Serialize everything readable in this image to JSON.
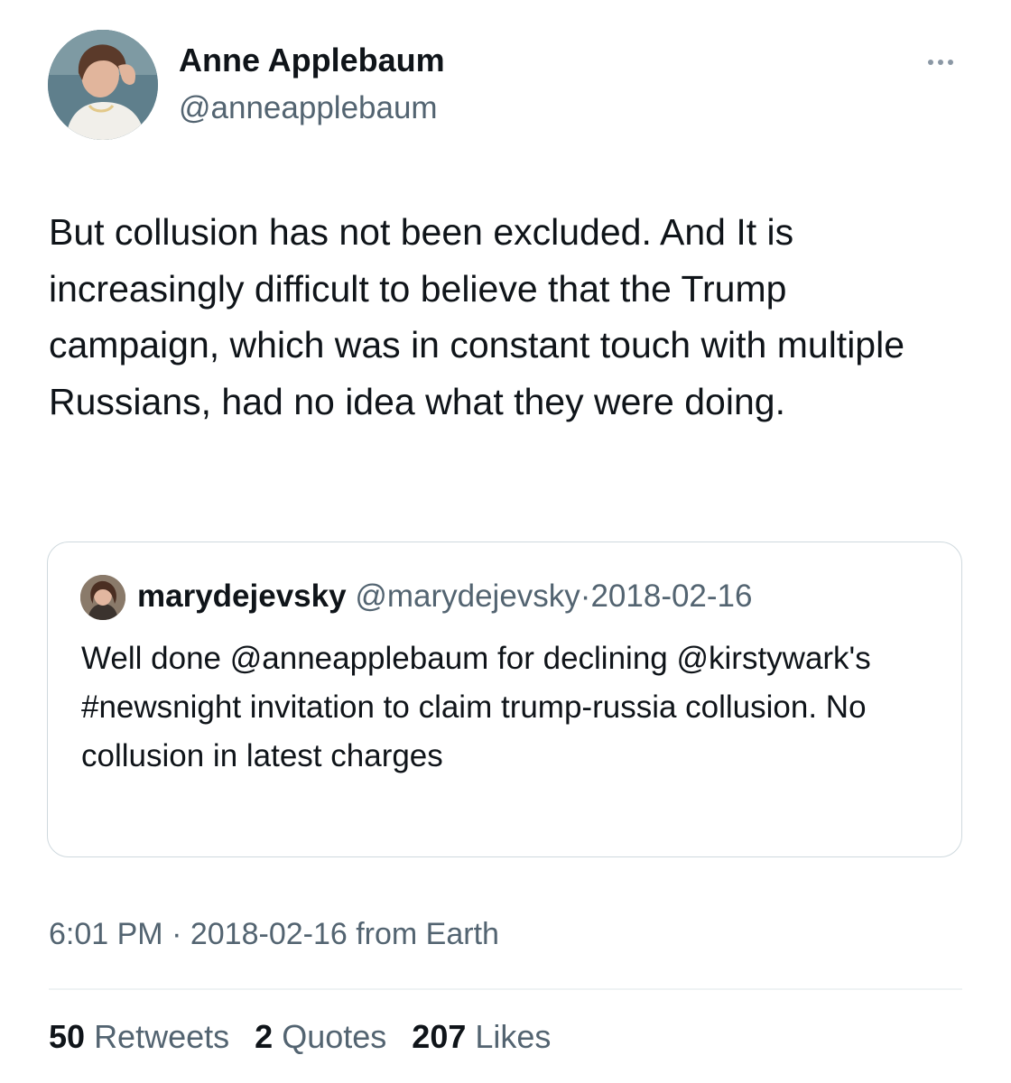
{
  "author": {
    "name": "Anne Applebaum",
    "handle": "@anneapplebaum",
    "avatar_icon": "author-avatar-photo"
  },
  "tweet": {
    "text": "But collusion has not been excluded. And It is increasingly difficult to believe that the Trump campaign, which was in constant touch with multiple Russians, had no idea what they were doing."
  },
  "quoted_tweet": {
    "name": "marydejevsky",
    "handle": "@marydejevsky",
    "separator": "·",
    "date": "2018-02-16",
    "text": "Well done @anneapplebaum for declining @kirstywark's #newsnight invitation to claim trump-russia collusion. No collusion in latest charges",
    "avatar_icon": "quoted-author-avatar-photo"
  },
  "timestamp": {
    "time": "6:01 PM",
    "separator": "·",
    "date": "2018-02-16",
    "source": "from Earth"
  },
  "stats": {
    "retweets": {
      "count": "50",
      "label": "Retweets"
    },
    "quotes": {
      "count": "2",
      "label": "Quotes"
    },
    "likes": {
      "count": "207",
      "label": "Likes"
    }
  },
  "colors": {
    "primary_text": "#0f1419",
    "secondary_text": "#536471",
    "border": "#cfd9de",
    "divider": "#eff3f4"
  }
}
